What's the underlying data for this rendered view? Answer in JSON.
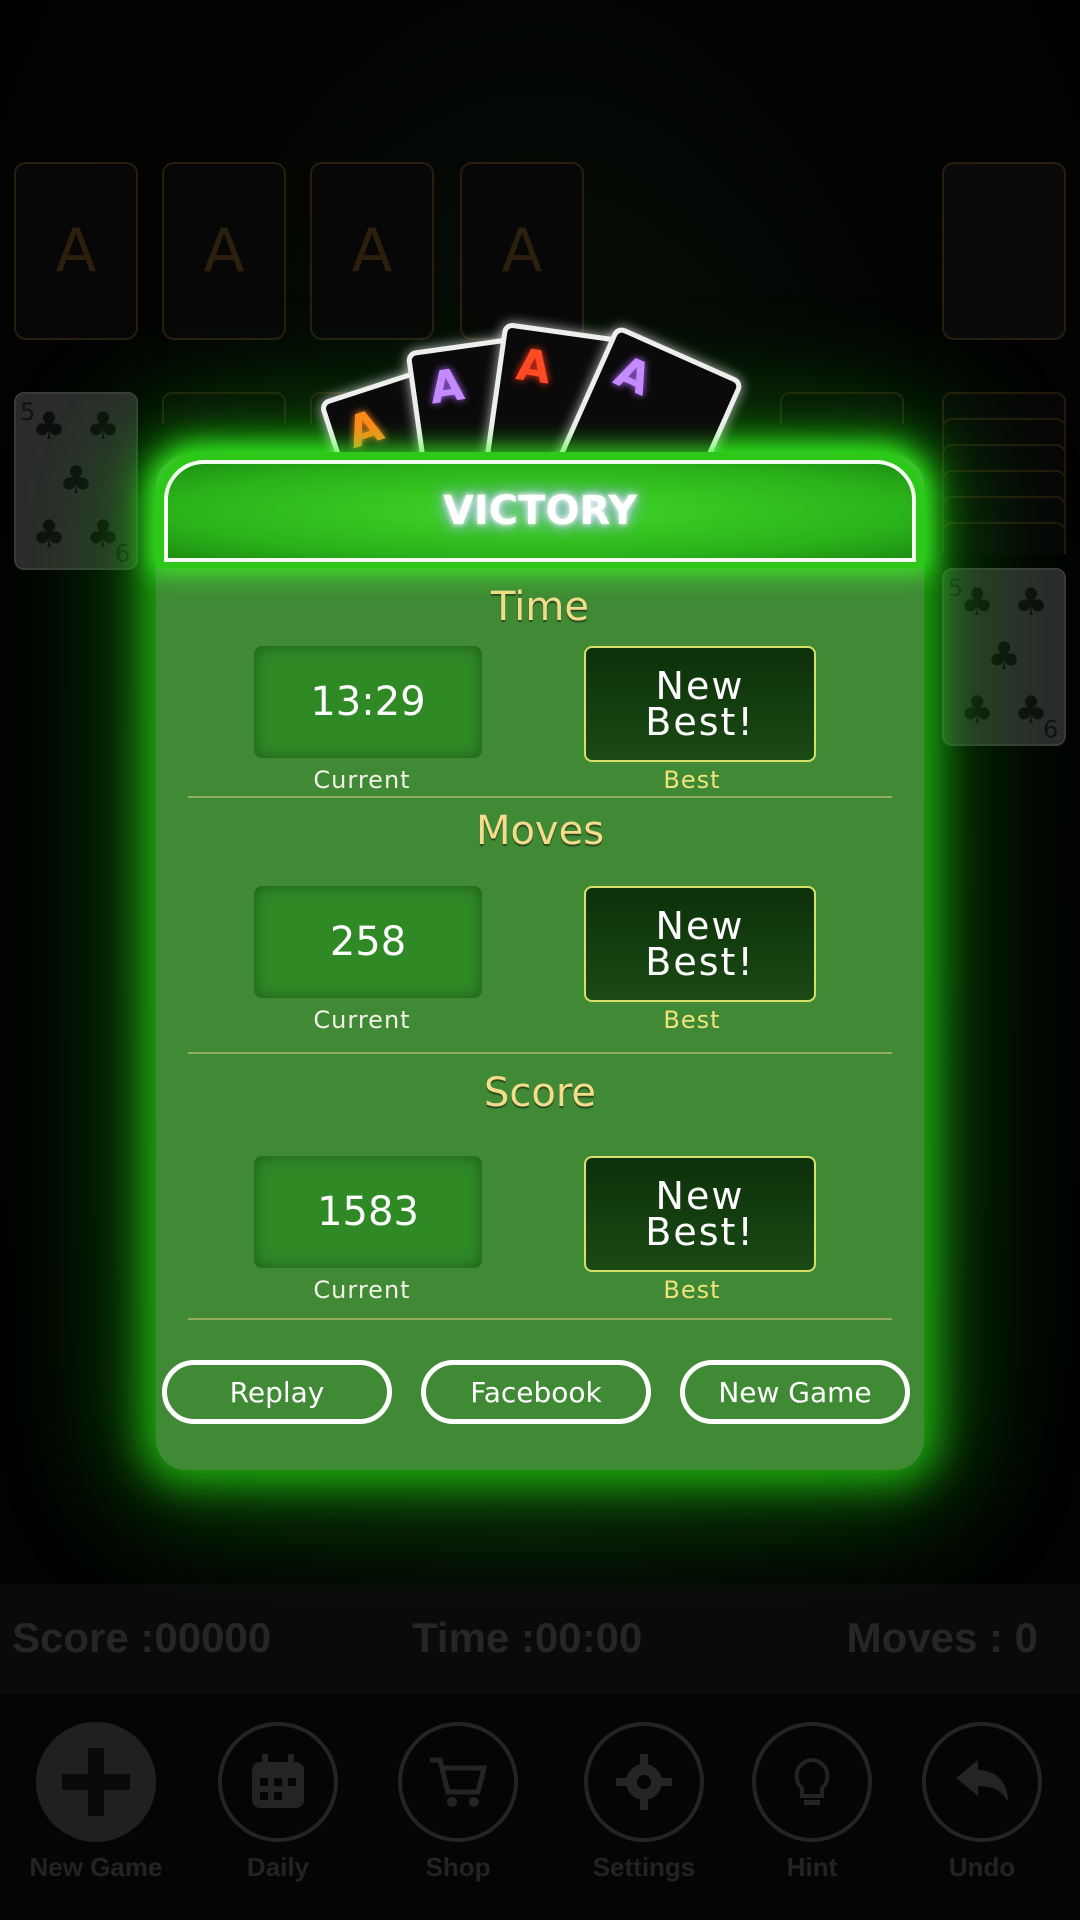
{
  "foundations": {
    "labels": [
      "A",
      "A",
      "A",
      "A"
    ]
  },
  "tableau": {
    "card_rank": "5",
    "bottom_rank": "9",
    "suit_symbol": "♣",
    "stub_rank": "5"
  },
  "victory": {
    "title": "VICTORY",
    "fan_cards": [
      "A",
      "A",
      "A",
      "A"
    ],
    "fan_colors": [
      "#ff8a1c",
      "#b46bff",
      "#ff3a1a",
      "#b46bff"
    ],
    "sections": [
      {
        "title": "Time",
        "current": "13:29",
        "current_label": "Current",
        "best": "New Best!",
        "best_label": "Best"
      },
      {
        "title": "Moves",
        "current": "258",
        "current_label": "Current",
        "best": "New Best!",
        "best_label": "Best"
      },
      {
        "title": "Score",
        "current": "1583",
        "current_label": "Current",
        "best": "New Best!",
        "best_label": "Best"
      }
    ],
    "buttons": {
      "replay": "Replay",
      "facebook": "Facebook",
      "new_game": "New Game"
    }
  },
  "status": {
    "score": "Score :00000",
    "time": "Time :00:00",
    "moves": "Moves : 0"
  },
  "nav": {
    "items": [
      {
        "label": "New Game",
        "icon": "plus-icon"
      },
      {
        "label": "Daily",
        "icon": "calendar-icon"
      },
      {
        "label": "Shop",
        "icon": "cart-icon"
      },
      {
        "label": "Settings",
        "icon": "gear-icon"
      },
      {
        "label": "Hint",
        "icon": "lightbulb-icon"
      },
      {
        "label": "Undo",
        "icon": "undo-icon"
      }
    ]
  },
  "colors": {
    "dialog": "#408a35",
    "banner": "#2dc81a",
    "gold_text": "#f3dd8a",
    "glow": "#28d214"
  }
}
